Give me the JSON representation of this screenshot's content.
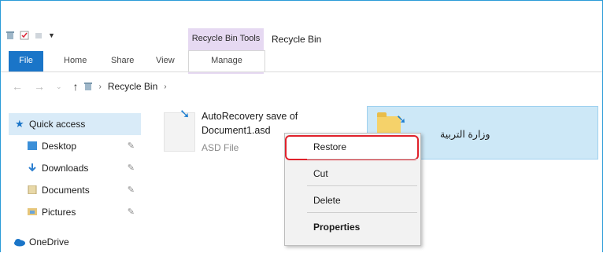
{
  "ribbon": {
    "context_group": "Recycle Bin Tools",
    "window_title": "Recycle Bin",
    "tabs": [
      "File",
      "Home",
      "Share",
      "View",
      "Manage"
    ]
  },
  "address": {
    "breadcrumb": [
      "Recycle Bin"
    ]
  },
  "nav_pane": {
    "quick_access": "Quick access",
    "items": [
      "Desktop",
      "Downloads",
      "Documents",
      "Pictures"
    ],
    "onedrive": "OneDrive"
  },
  "files": [
    {
      "name_line1": "AutoRecovery save of",
      "name_line2": "Document1.asd",
      "type": "ASD File"
    },
    {
      "name": "وزارة التربية"
    }
  ],
  "context_menu": {
    "items": [
      "Restore",
      "Cut",
      "Delete",
      "Properties"
    ],
    "highlight_color": "#e0212b"
  },
  "colors": {
    "file_tab": "#1a75c8",
    "context_tab": "#e6d9f2",
    "selection": "#cde8f7"
  }
}
